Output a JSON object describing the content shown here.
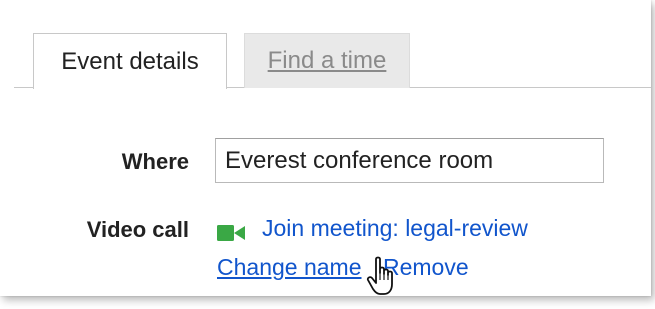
{
  "tabs": {
    "event_details": "Event details",
    "find_a_time": "Find a time"
  },
  "where": {
    "label": "Where",
    "value": "Everest conference room"
  },
  "video_call": {
    "label": "Video call",
    "icon": "video-camera-icon",
    "icon_color": "#3aa845",
    "join_link": "Join meeting: legal-review",
    "change_name": "Change name",
    "separator": "|",
    "remove": "Remove"
  },
  "colors": {
    "link": "#1155cc",
    "inactive_tab_bg": "#e9e9e9"
  },
  "cursor": "hand-pointer-icon"
}
